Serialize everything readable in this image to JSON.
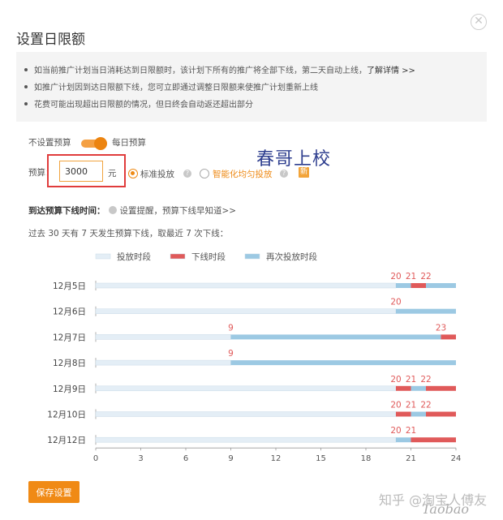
{
  "dialog": {
    "title": "设置日限额",
    "close_icon": "close-circle-icon"
  },
  "notice": {
    "items": [
      {
        "text": "如当前推广计划当日消耗达到日限额时，该计划下所有的推广将全部下线，第二天自动上线，",
        "link": "了解详情 >>"
      },
      {
        "text": "如推广计划因到达日限额下线，您可立即通过调整日限额来使推广计划重新上线",
        "link": ""
      },
      {
        "text": "花费可能出现超出日限额的情况，但日终会自动返还超出部分",
        "link": ""
      }
    ]
  },
  "budget_toggle": {
    "left_label": "不设置预算",
    "right_label": "每日预算",
    "state": "on"
  },
  "budget": {
    "label": "预算：",
    "value": "3000",
    "unit": "元",
    "option_standard": "标准投放",
    "option_smart": "智能化均匀投放",
    "selected": "标准投放",
    "new_badge": "新"
  },
  "offline_alert": {
    "label": "到达预算下线时间：",
    "link": "设置提醒，预算下线早知道>>"
  },
  "summary": "过去 30 天有 7 天发生预算下线，取最近 7 次下线：",
  "chart_data": {
    "type": "timeline",
    "legend": [
      {
        "name": "投放时段",
        "color": "#e4eef6"
      },
      {
        "name": "下线时段",
        "color": "#e05a5a"
      },
      {
        "name": "再次投放时段",
        "color": "#9cc9e3"
      }
    ],
    "x_ticks": [
      0,
      3,
      6,
      9,
      12,
      15,
      18,
      21,
      24
    ],
    "xlim": [
      0,
      24
    ],
    "rows": [
      {
        "date": "12月5日",
        "segments": [
          {
            "from": 0,
            "to": 20,
            "kind": "投放时段"
          },
          {
            "from": 20,
            "to": 21,
            "kind": "再次投放时段"
          },
          {
            "from": 21,
            "to": 22,
            "kind": "下线时段"
          },
          {
            "from": 22,
            "to": 24,
            "kind": "再次投放时段"
          }
        ],
        "labels": [
          {
            "at": 20,
            "text": "20"
          },
          {
            "at": 21,
            "text": "21"
          },
          {
            "at": 22,
            "text": "22"
          }
        ]
      },
      {
        "date": "12月6日",
        "segments": [
          {
            "from": 0,
            "to": 20,
            "kind": "投放时段"
          },
          {
            "from": 20,
            "to": 24,
            "kind": "再次投放时段"
          }
        ],
        "labels": [
          {
            "at": 20,
            "text": "20"
          }
        ]
      },
      {
        "date": "12月7日",
        "segments": [
          {
            "from": 0,
            "to": 9,
            "kind": "投放时段"
          },
          {
            "from": 9,
            "to": 23,
            "kind": "再次投放时段"
          },
          {
            "from": 23,
            "to": 24,
            "kind": "下线时段"
          }
        ],
        "labels": [
          {
            "at": 9,
            "text": "9"
          },
          {
            "at": 23,
            "text": "23"
          }
        ]
      },
      {
        "date": "12月8日",
        "segments": [
          {
            "from": 0,
            "to": 9,
            "kind": "投放时段"
          },
          {
            "from": 9,
            "to": 24,
            "kind": "再次投放时段"
          }
        ],
        "labels": [
          {
            "at": 9,
            "text": "9"
          }
        ]
      },
      {
        "date": "12月9日",
        "segments": [
          {
            "from": 0,
            "to": 20,
            "kind": "投放时段"
          },
          {
            "from": 20,
            "to": 21,
            "kind": "下线时段"
          },
          {
            "from": 21,
            "to": 22,
            "kind": "再次投放时段"
          },
          {
            "from": 22,
            "to": 24,
            "kind": "下线时段"
          }
        ],
        "labels": [
          {
            "at": 20,
            "text": "20"
          },
          {
            "at": 21,
            "text": "21"
          },
          {
            "at": 22,
            "text": "22"
          }
        ]
      },
      {
        "date": "12月10日",
        "segments": [
          {
            "from": 0,
            "to": 20,
            "kind": "投放时段"
          },
          {
            "from": 20,
            "to": 21,
            "kind": "下线时段"
          },
          {
            "from": 21,
            "to": 22,
            "kind": "再次投放时段"
          },
          {
            "from": 22,
            "to": 24,
            "kind": "下线时段"
          }
        ],
        "labels": [
          {
            "at": 20,
            "text": "20"
          },
          {
            "at": 21,
            "text": "21"
          },
          {
            "at": 22,
            "text": "22"
          }
        ]
      },
      {
        "date": "12月12日",
        "segments": [
          {
            "from": 0,
            "to": 20,
            "kind": "投放时段"
          },
          {
            "from": 20,
            "to": 21,
            "kind": "再次投放时段"
          },
          {
            "from": 21,
            "to": 24,
            "kind": "下线时段"
          }
        ],
        "labels": [
          {
            "at": 20,
            "text": "20"
          },
          {
            "at": 21,
            "text": "21"
          }
        ]
      }
    ]
  },
  "footer": {
    "save_label": "保存设置"
  },
  "watermarks": {
    "handwritten": "春哥上校",
    "site": "知乎 @淘宝人傅友",
    "brand": "Taobao"
  }
}
